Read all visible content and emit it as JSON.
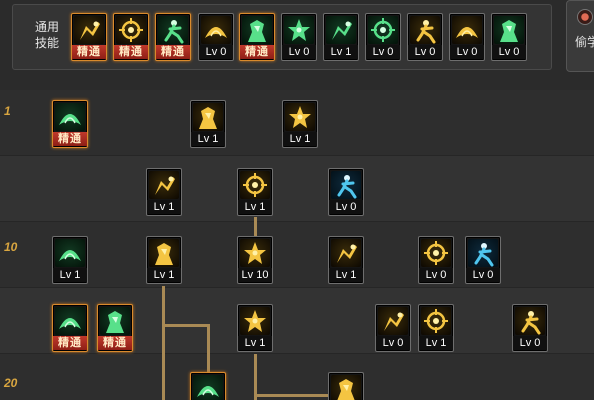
{
  "general": {
    "label_line1": "通用",
    "label_line2": "技能",
    "skills": [
      {
        "icon": "seated-figure-icon",
        "level": "精通",
        "master": true,
        "palette": "gold"
      },
      {
        "icon": "kneeling-figure-icon",
        "level": "精通",
        "master": true,
        "palette": "gold"
      },
      {
        "icon": "running-figure-icon",
        "level": "精通",
        "master": true,
        "palette": "green"
      },
      {
        "icon": "winged-emblem-icon",
        "level": "Lv 0",
        "master": false,
        "palette": "gold"
      },
      {
        "icon": "crosshair-icon",
        "level": "精通",
        "master": true,
        "palette": "green"
      },
      {
        "icon": "target-circle-icon",
        "level": "Lv 0",
        "master": false,
        "palette": "green"
      },
      {
        "icon": "leaping-figure-icon",
        "level": "Lv 1",
        "master": false,
        "palette": "green"
      },
      {
        "icon": "grappling-figure-icon",
        "level": "Lv 0",
        "master": false,
        "palette": "green"
      },
      {
        "icon": "vortex-orb-icon",
        "level": "Lv 0",
        "master": false,
        "palette": "gold"
      },
      {
        "icon": "strongman-figure-icon",
        "level": "Lv 0",
        "master": false,
        "palette": "gold"
      },
      {
        "icon": "green-warrior-icon",
        "level": "Lv 0",
        "master": false,
        "palette": "green"
      }
    ]
  },
  "right_tab": {
    "label": "偷学"
  },
  "tree": {
    "level_markers": [
      "1",
      "10",
      "20"
    ],
    "skills": [
      {
        "id": "s1",
        "icon": "hand-grab-icon",
        "level": "精通",
        "master": true,
        "palette": "green"
      },
      {
        "id": "s2",
        "icon": "upward-kick-icon",
        "level": "Lv 1",
        "master": false,
        "palette": "gold"
      },
      {
        "id": "s3",
        "icon": "slash-strike-icon",
        "level": "Lv 1",
        "master": false,
        "palette": "gold"
      },
      {
        "id": "s4",
        "icon": "burst-explosion-icon",
        "level": "Lv 1",
        "master": false,
        "palette": "gold"
      },
      {
        "id": "s5",
        "icon": "speed-dash-icon",
        "level": "Lv 1",
        "master": false,
        "palette": "gold"
      },
      {
        "id": "s6",
        "icon": "throw-projectile-icon",
        "level": "Lv 0",
        "master": false,
        "palette": "blue"
      },
      {
        "id": "s7",
        "icon": "claw-grab-icon",
        "level": "Lv 1",
        "master": false,
        "palette": "green"
      },
      {
        "id": "s8",
        "icon": "arc-slash-icon",
        "level": "Lv 1",
        "master": false,
        "palette": "gold"
      },
      {
        "id": "s9",
        "icon": "fist-impact-icon",
        "level": "Lv 10",
        "master": false,
        "palette": "gold"
      },
      {
        "id": "s10",
        "icon": "lightning-claw-icon",
        "level": "Lv 1",
        "master": false,
        "palette": "gold"
      },
      {
        "id": "s11",
        "icon": "rising-arrow-icon",
        "level": "Lv 0",
        "master": false,
        "palette": "gold"
      },
      {
        "id": "s12",
        "icon": "winged-totem-icon",
        "level": "Lv 0",
        "master": false,
        "palette": "blue"
      },
      {
        "id": "s13",
        "icon": "archer-figure-icon",
        "level": "精通",
        "master": true,
        "palette": "green"
      },
      {
        "id": "s14",
        "icon": "sweeping-hand-icon",
        "level": "精通",
        "master": true,
        "palette": "green"
      },
      {
        "id": "s15",
        "icon": "hooded-figure-icon",
        "level": "Lv 1",
        "master": false,
        "palette": "gold"
      },
      {
        "id": "s16",
        "icon": "sand-wave-icon",
        "level": "Lv 0",
        "master": false,
        "palette": "gold"
      },
      {
        "id": "s17",
        "icon": "flying-kick-icon",
        "level": "Lv 1",
        "master": false,
        "palette": "gold"
      },
      {
        "id": "s18",
        "icon": "grenade-icon",
        "level": "Lv 0",
        "master": false,
        "palette": "gold"
      },
      {
        "id": "s19",
        "icon": "spinning-wind-icon",
        "level": "",
        "master": true,
        "palette": "green"
      },
      {
        "id": "s20",
        "icon": "shield-mask-icon",
        "level": "",
        "master": false,
        "palette": "gold"
      }
    ]
  }
}
